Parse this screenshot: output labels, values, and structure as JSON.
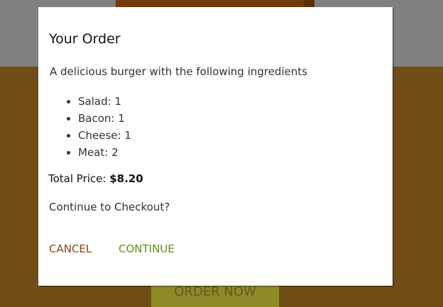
{
  "background": {
    "order_button_label": "ORDER NOW"
  },
  "modal": {
    "title": "Your Order",
    "description": "A delicious burger with the following ingredients",
    "ingredients": [
      {
        "name": "Salad",
        "qty": "1"
      },
      {
        "name": "Bacon",
        "qty": "1"
      },
      {
        "name": "Cheese",
        "qty": "1"
      },
      {
        "name": "Meat",
        "qty": "2"
      }
    ],
    "total_label": "Total Price:",
    "total_value": "$8.20",
    "checkout_question": "Continue to Checkout?",
    "cancel_label": "CANCEL",
    "continue_label": "CONTINUE"
  },
  "colors": {
    "toolbar": "#808080",
    "background": "#6f4d14",
    "cancel": "#944317",
    "continue": "#5c9210"
  }
}
